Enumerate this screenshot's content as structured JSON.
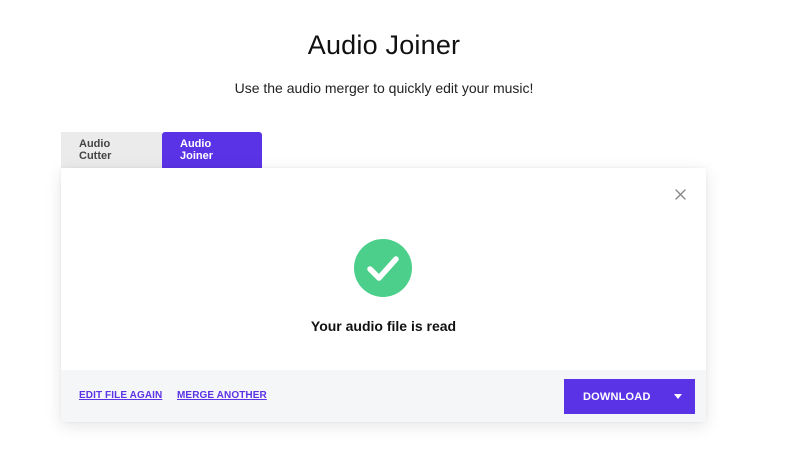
{
  "page": {
    "title": "Audio Joiner",
    "subtitle": "Use the audio merger to quickly edit your music!"
  },
  "tabs": [
    {
      "label": "Audio Cutter",
      "active": false
    },
    {
      "label": "Audio Joiner",
      "active": true
    }
  ],
  "card": {
    "close_icon": "close-icon",
    "success_icon": "check-circle-icon",
    "status_text": "Your audio file is read",
    "footer": {
      "edit_link": "EDIT FILE AGAIN",
      "merge_link": "MERGE ANOTHER",
      "download_label": "DOWNLOAD",
      "dropdown_icon": "caret-down-icon"
    }
  },
  "colors": {
    "accent": "#5b33e6",
    "success": "#4ccf8a",
    "inactive_tab": "#ebebeb",
    "footer_bg": "#f5f6f8"
  }
}
